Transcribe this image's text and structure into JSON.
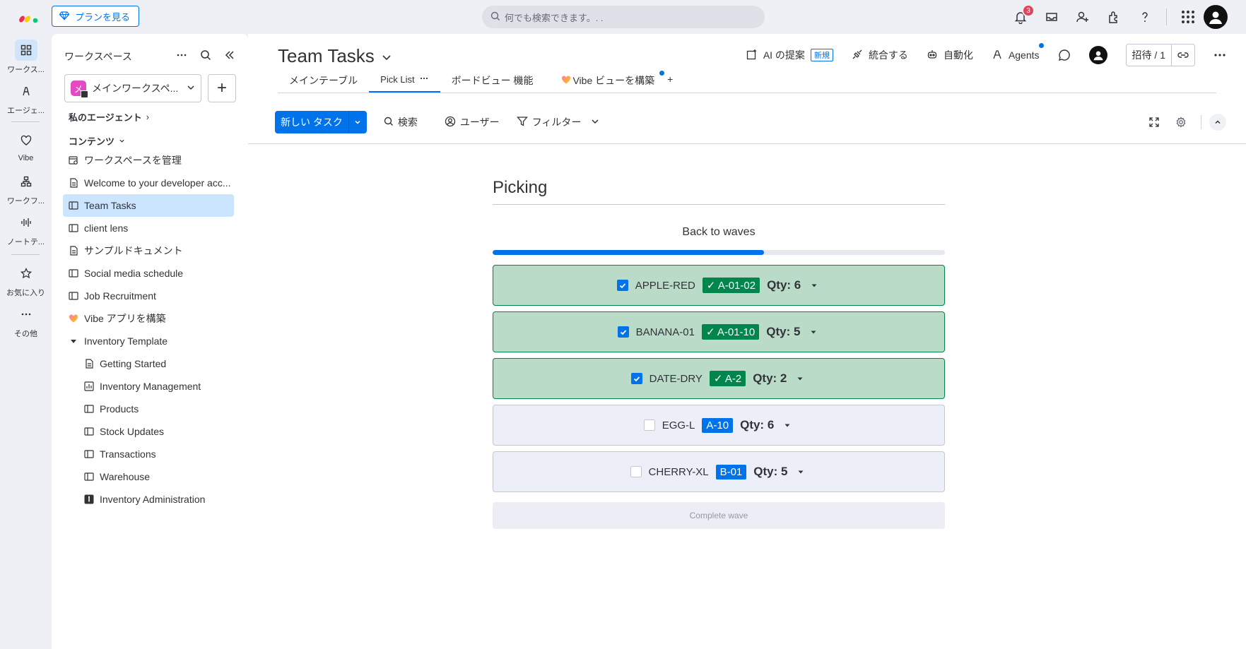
{
  "topbar": {
    "plans_label": "プランを見る",
    "search_placeholder": "何でも検索できます。. .",
    "notification_count": "3"
  },
  "rail": {
    "items": [
      {
        "label": "ワークス...",
        "icon": "grid-icon"
      },
      {
        "label": "エージェ...",
        "icon": "agent-icon"
      },
      {
        "label": "Vibe",
        "icon": "vibe-heart-icon"
      },
      {
        "label": "ワークフ...",
        "icon": "workflow-icon"
      },
      {
        "label": "ノートテ...",
        "icon": "audio-wave-icon"
      },
      {
        "label": "お気に入り",
        "icon": "star-icon"
      },
      {
        "label": "その他",
        "icon": "more-icon"
      }
    ]
  },
  "sidebar": {
    "header": "ワークスペース",
    "workspace_name": "メインワークスペ...",
    "workspace_initial": "メ",
    "my_agents": "私のエージェント",
    "contents": "コンテンツ",
    "items": [
      {
        "label": "ワークスペースを管理",
        "icon": "settings-board-icon"
      },
      {
        "label": "Welcome to your developer acc...",
        "icon": "doc-icon"
      },
      {
        "label": "Team Tasks",
        "icon": "board-icon"
      },
      {
        "label": "client lens",
        "icon": "board-icon"
      },
      {
        "label": "サンプルドキュメント",
        "icon": "doc-icon"
      },
      {
        "label": "Social media schedule",
        "icon": "board-icon"
      },
      {
        "label": "Job Recruitment",
        "icon": "board-icon"
      },
      {
        "label": "Vibe アプリを構築",
        "icon": "vibe-heart-icon"
      },
      {
        "label": "Inventory Template",
        "icon": "caret-down-icon"
      }
    ],
    "sub_items": [
      {
        "label": "Getting Started",
        "icon": "doc-icon"
      },
      {
        "label": "Inventory Management",
        "icon": "dashboard-icon"
      },
      {
        "label": "Products",
        "icon": "board-icon"
      },
      {
        "label": "Stock Updates",
        "icon": "board-icon"
      },
      {
        "label": "Transactions",
        "icon": "board-icon"
      },
      {
        "label": "Warehouse",
        "icon": "board-icon"
      },
      {
        "label": "Inventory Administration",
        "icon": "app-icon"
      }
    ]
  },
  "board": {
    "title": "Team Tasks",
    "actions": {
      "ai": "AI の提案",
      "ai_badge": "新規",
      "integrate": "統合する",
      "automate": "自動化",
      "agents": "Agents",
      "invite": "招待 / 1"
    },
    "tabs": [
      "メインテーブル",
      "Pick List",
      "ボードビュー 機能",
      "Vibe ビューを構築"
    ],
    "toolbar": {
      "new_task": "新しい タスク",
      "search": "検索",
      "user": "ユーザー",
      "filter": "フィルター"
    }
  },
  "picking": {
    "title": "Picking",
    "back": "Back to waves",
    "progress": 0.6,
    "rows": [
      {
        "sku": "APPLE-RED",
        "location": "✓ A-01-02",
        "qty": "Qty: 6",
        "done": true
      },
      {
        "sku": "BANANA-01",
        "location": "✓ A-01-10",
        "qty": "Qty: 5",
        "done": true
      },
      {
        "sku": "DATE-DRY",
        "location": "✓ A-2",
        "qty": "Qty: 2",
        "done": true
      },
      {
        "sku": "EGG-L",
        "location": "A-10",
        "qty": "Qty: 6",
        "done": false
      },
      {
        "sku": "CHERRY-XL",
        "location": "B-01",
        "qty": "Qty: 5",
        "done": false
      }
    ],
    "complete": "Complete wave"
  },
  "colors": {
    "accent": "#0073ea",
    "done_bg": "#bbdbc9",
    "done_tag": "#00854d"
  }
}
